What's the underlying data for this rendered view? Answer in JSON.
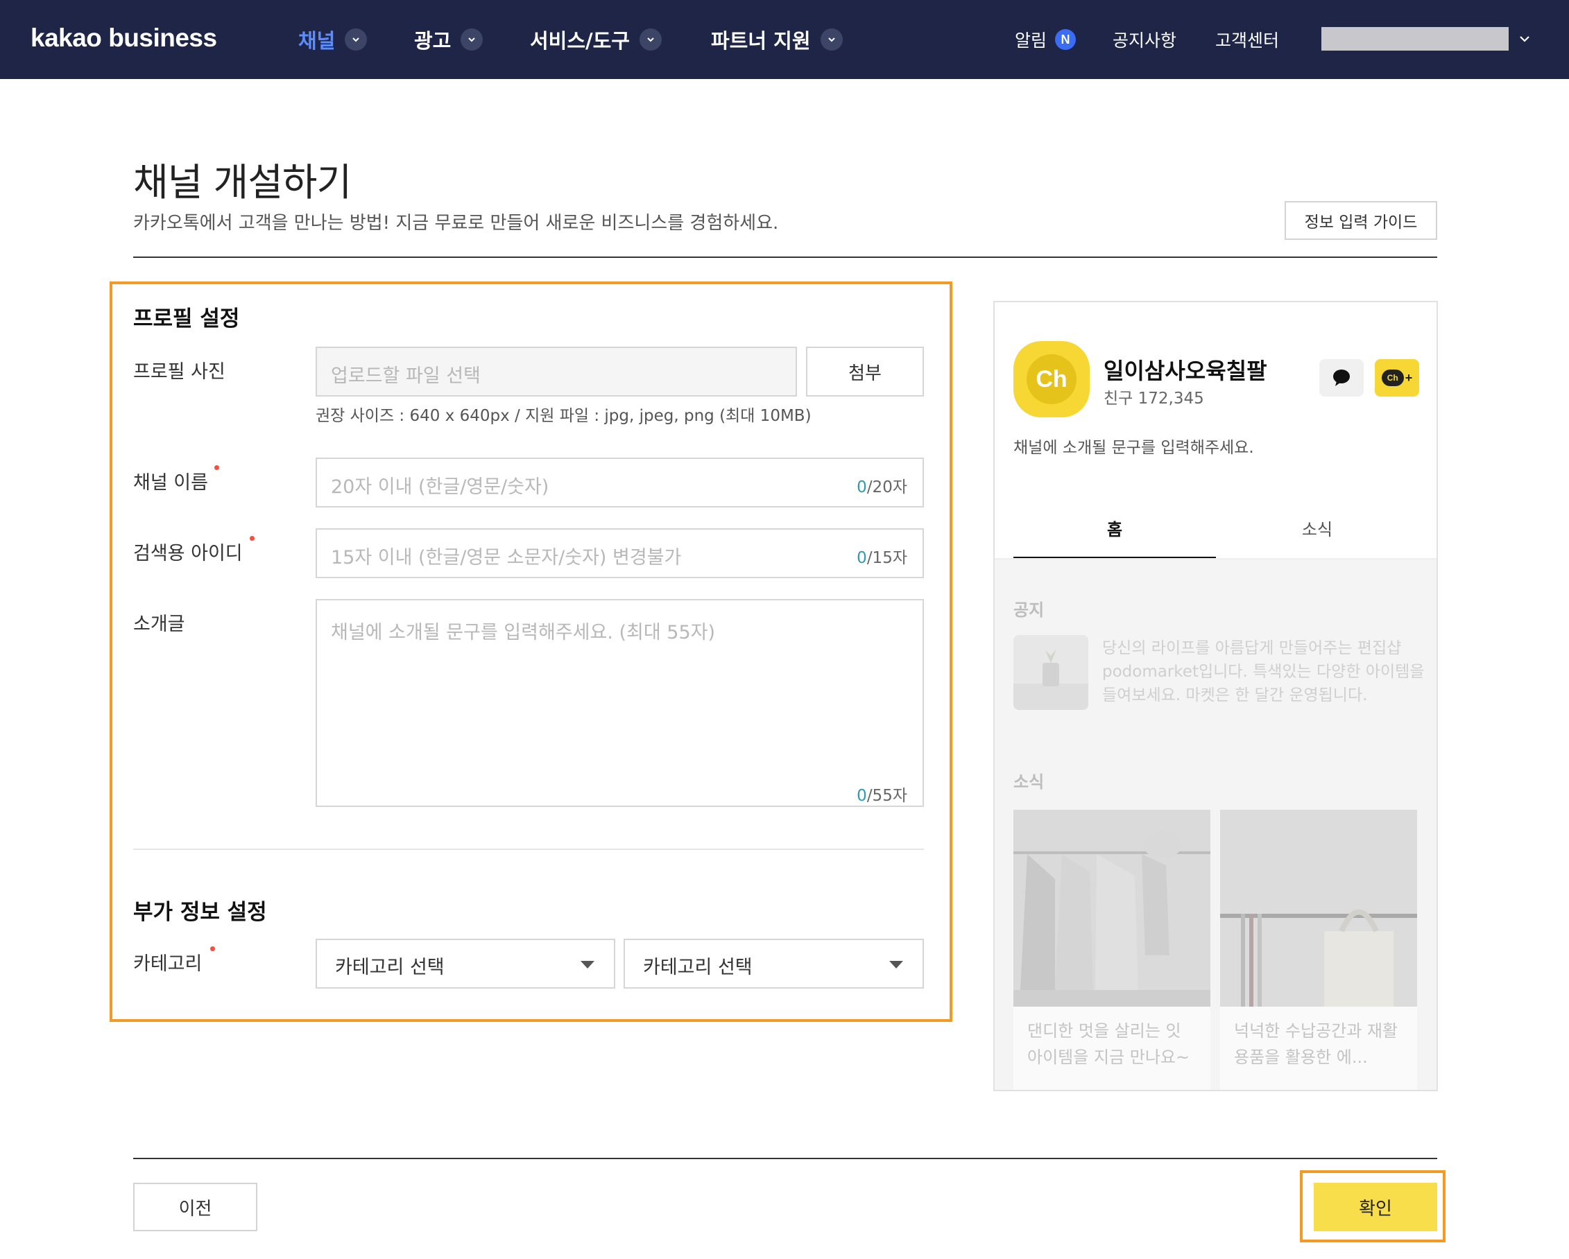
{
  "header": {
    "logo": "kakao business",
    "nav": [
      {
        "label": "채널",
        "active": true
      },
      {
        "label": "광고",
        "active": false
      },
      {
        "label": "서비스/도구",
        "active": false
      },
      {
        "label": "파트너 지원",
        "active": false
      }
    ],
    "alerts_label": "알림",
    "alerts_badge": "N",
    "notice_label": "공지사항",
    "support_label": "고객센터",
    "account_masked": true
  },
  "page": {
    "title": "채널 개설하기",
    "subtitle": "카카오톡에서 고객을 만나는 방법! 지금 무료로 만들어 새로운 비즈니스를 경험하세요.",
    "guide_button": "정보 입력 가이드"
  },
  "form": {
    "profile_section_title": "프로필 설정",
    "photo": {
      "label": "프로필 사진",
      "placeholder": "업로드할 파일 선택",
      "attach_button": "첨부",
      "hint": "권장 사이즈 : 640 x 640px / 지원 파일 : jpg, jpeg, png (최대 10MB)"
    },
    "channel_name": {
      "label": "채널 이름",
      "required": true,
      "placeholder": "20자 이내 (한글/영문/숫자)",
      "count": "0",
      "max": "/20자"
    },
    "search_id": {
      "label": "검색용 아이디",
      "required": true,
      "placeholder": "15자 이내 (한글/영문 소문자/숫자) 변경불가",
      "count": "0",
      "max": "/15자"
    },
    "intro": {
      "label": "소개글",
      "placeholder": "채널에 소개될 문구를 입력해주세요. (최대 55자)",
      "count": "0",
      "max": "/55자"
    },
    "extra_section_title": "부가 정보 설정",
    "category": {
      "label": "카테고리",
      "required": true,
      "select1": "카테고리 선택",
      "select2": "카테고리 선택"
    }
  },
  "preview": {
    "avatar_text": "Ch",
    "name": "일이삼사오육칠팔",
    "friends": "친구 172,345",
    "description": "채널에 소개될 문구를 입력해주세요.",
    "chplus_text": "Ch",
    "tabs": [
      {
        "label": "홈",
        "active": true
      },
      {
        "label": "소식",
        "active": false
      }
    ],
    "notice_title": "공지",
    "notice_text": "당신의 라이프를 아름답게 만들어주는 편집샵 podomarket입니다. 특색있는 다양한 아이템을 들여보세요. 마켓은 한 달간 운영됩니다.",
    "news_title": "소식",
    "cards": [
      {
        "text": "댄디한 멋을 살리는 잇 아이템을 지금 만나요~"
      },
      {
        "text": "넉넉한 수납공간과 재활용품을 활용한 에..."
      }
    ]
  },
  "footer": {
    "prev_button": "이전",
    "ok_button": "확인"
  },
  "colors": {
    "topbar": "#1f2547",
    "nav_active": "#5b8dff",
    "highlight": "#f39a25",
    "kakao_yellow": "#f7de4a",
    "required_dot": "#ff4b3b",
    "counter_zero": "#2b9bb6"
  }
}
